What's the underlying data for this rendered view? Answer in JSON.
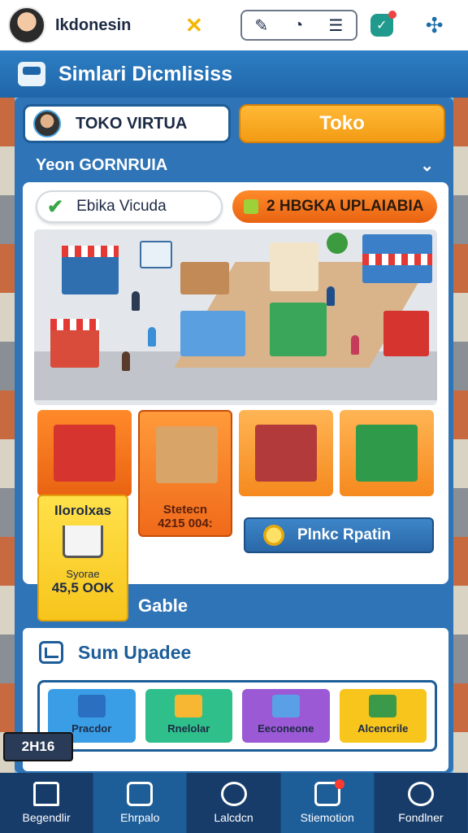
{
  "topbar": {
    "user_name": "Ikdonesin",
    "close_glyph": "✕",
    "tools": [
      "✎",
      "◔",
      "☰"
    ],
    "shield_glyph": "✓"
  },
  "title": "Simlari Dicmlisiss",
  "shop_row": {
    "shop_label": "TOKO VIRTUA",
    "toko_button": "Toko"
  },
  "section_header": "Yeon GORNRUIA",
  "section_chevron": "⌄",
  "map": {
    "tab_label": "Ebika Vicuda",
    "upload_badge": "2 HBGKA UPLAIABIA"
  },
  "sale_card": {
    "title": "Ilorolxas",
    "subtitle": "Syorae",
    "value": "45,5 OOK"
  },
  "stock_card": {
    "line1": "Stetecn",
    "line2": "4215 004:"
  },
  "action_button": "Plnkc Rpatin",
  "gable_label": "Gable",
  "summary": {
    "title": "Sum Upadee",
    "stats": [
      {
        "label": "Pracdor",
        "color": "#3a9ee6"
      },
      {
        "label": "Rnelolar",
        "color": "#2ebf8a"
      },
      {
        "label": "Eeconeone",
        "color": "#9b59d6"
      },
      {
        "label": "Alcencrile",
        "color": "#f7c51c"
      }
    ]
  },
  "timer": "2H16",
  "bottom_nav": [
    {
      "label": "Begendlir",
      "icon": "home-icon"
    },
    {
      "label": "Ehrpalo",
      "icon": "wallet-icon"
    },
    {
      "label": "Lalcdcn",
      "icon": "compass-icon"
    },
    {
      "label": "Stiemotion",
      "icon": "notification-icon"
    },
    {
      "label": "Fondlner",
      "icon": "user-icon"
    }
  ]
}
